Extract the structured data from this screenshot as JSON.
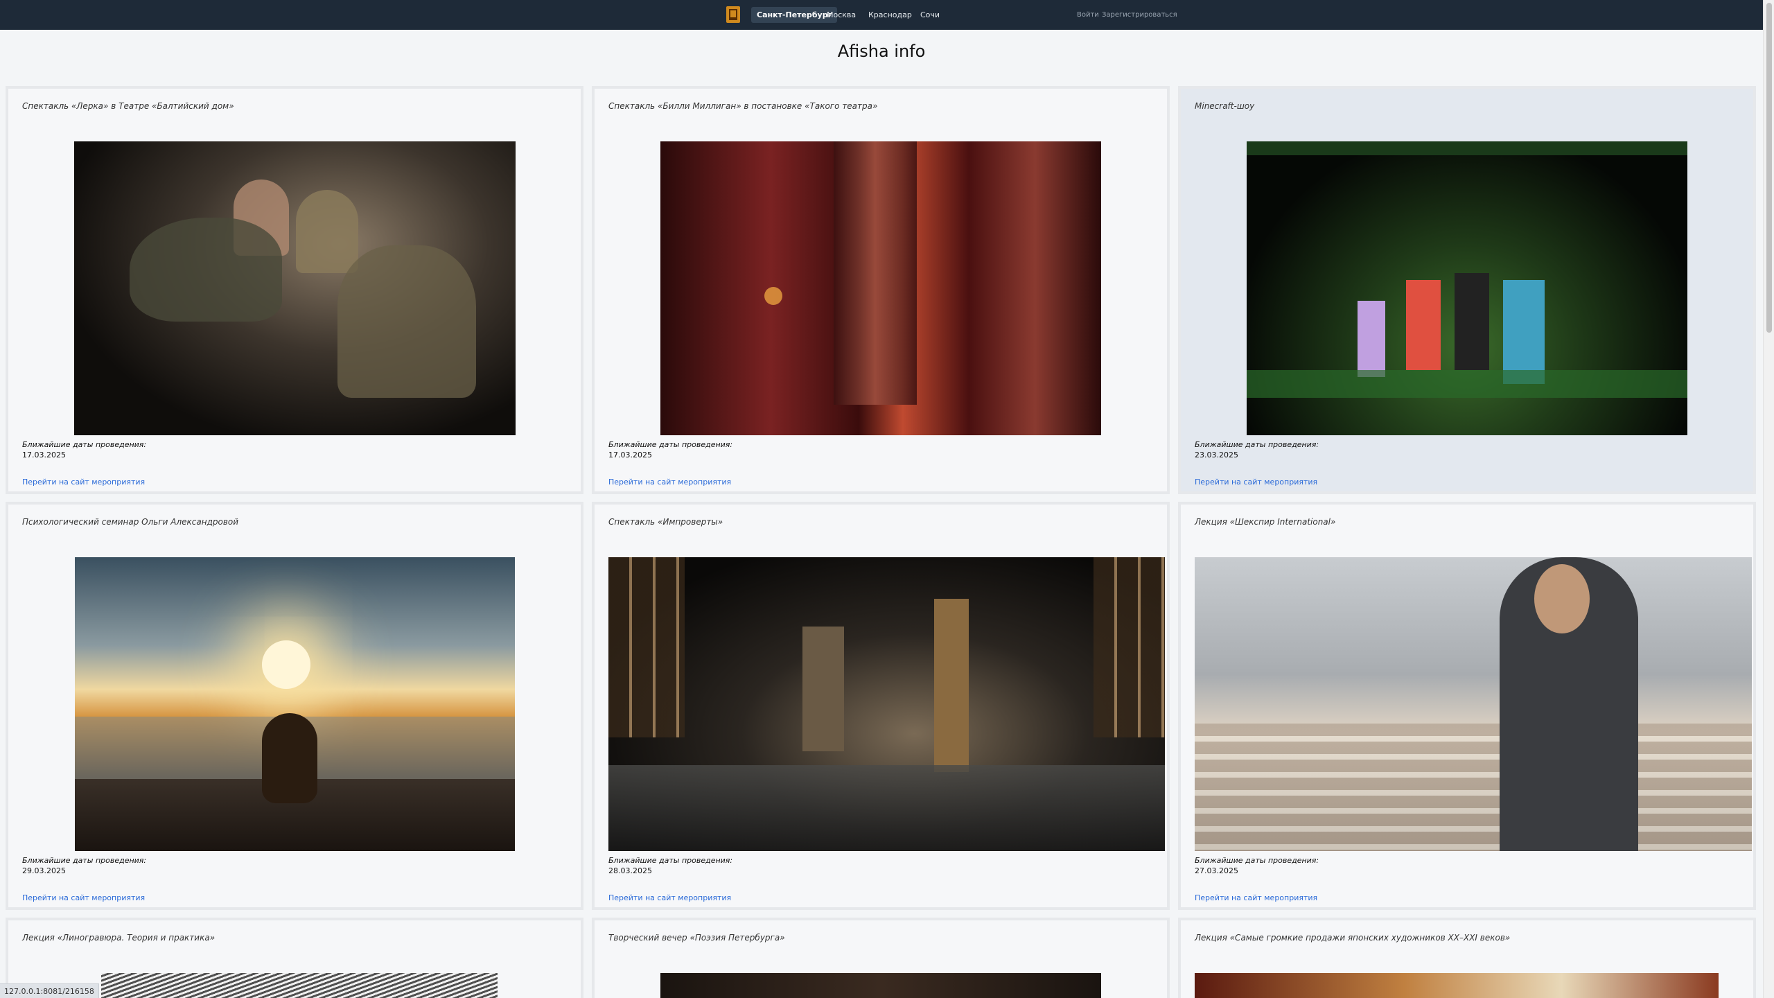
{
  "nav": {
    "logo_icon": "afisha-logo-icon",
    "cities": [
      "Санкт-Петербург",
      "Москва",
      "Краснодар",
      "Сочи"
    ],
    "active_city": "Санкт-Петербург",
    "login": "Войти",
    "register": "Зарегистрироваться"
  },
  "page": {
    "title": "Afisha info"
  },
  "labels": {
    "dates_label": "Ближайшие даты проведения:",
    "link_label": "Перейти на сайт мероприятия"
  },
  "events": [
    {
      "title": "Спектакль «Лерка» в Театре «Балтийский дом»",
      "date": "17.03.2025"
    },
    {
      "title": "Спектакль «Билли Миллиган» в постановке «Такого театра»",
      "date": "17.03.2025"
    },
    {
      "title": "Minecraft-шоу",
      "date": "23.03.2025"
    },
    {
      "title": "Психологический семинар Ольги Александровой",
      "date": "29.03.2025"
    },
    {
      "title": "Спектакль «Импроверты»",
      "date": "28.03.2025"
    },
    {
      "title": "Лекция «Шекспир International»",
      "date": "27.03.2025"
    },
    {
      "title": "Лекция «Линогравюра. Теория и практика»",
      "date": ""
    },
    {
      "title": "Творческий вечер «Поэзия Петербурга»",
      "date": ""
    },
    {
      "title": "Лекция «Самые громкие продажи японских художников XX–XXI веков»",
      "date": ""
    }
  ],
  "status_bar": {
    "url": "127.0.0.1:8081/216158"
  },
  "colors": {
    "nav_bg": "#1e2a38",
    "page_bg": "#f3f5f7",
    "link": "#2a6ad8",
    "logo": "#d08a1e"
  }
}
